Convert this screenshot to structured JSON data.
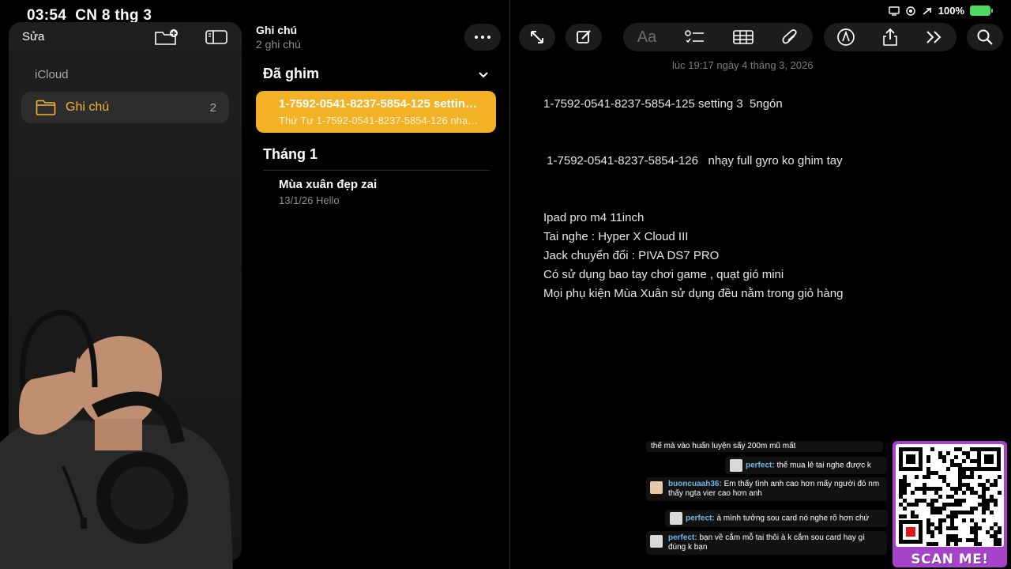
{
  "status_bar": {
    "time": "03:54",
    "date": "CN 8 thg 3",
    "battery": "100%"
  },
  "sidebar": {
    "edit_label": "Sửa",
    "section": "iCloud",
    "folder": {
      "label": "Ghi chú",
      "count": "2"
    }
  },
  "note_list": {
    "title": "Ghi chú",
    "subtitle": "2 ghi chú",
    "pinned_header": "Đã ghim",
    "pinned_note": {
      "title": "1-7592-0541-8237-5854-125 setting 3 5ngón",
      "subtitle": "Thứ Tư  1-7592-0541-8237-5854-126 nhạy full gyro"
    },
    "month_header": "Tháng 1",
    "note": {
      "title": "Mùa xuân đẹp zai",
      "subtitle": "13/1/26  Hello"
    }
  },
  "editor": {
    "timestamp": "lúc 19:17 ngày 4 tháng 3, 2026",
    "format_label": "Aa",
    "lines": [
      "1-7592-0541-8237-5854-125 setting 3  5ngón",
      "",
      "",
      " 1-7592-0541-8237-5854-126   nhạy full gyro ko ghim tay",
      "",
      "",
      "Ipad pro m4 11inch",
      "Tai nghe : Hyper X Cloud III",
      "Jack chuyển đổi : PIVA DS7 PRO",
      "Có sử dụng bao tay chơi game , quạt gió mini",
      "Mọi phụ kiện Mùa Xuân sử dụng đều nằm trong giỏ hàng"
    ]
  },
  "chat": {
    "messages": [
      {
        "name": "",
        "text": "thế mà vào huấn luyện sấy 200m mũ mất"
      },
      {
        "name": "perfect:",
        "text": "thế mua lẻ tai nghe được k"
      },
      {
        "name": "buoncuaah36:",
        "text": "Em thấy tình anh cao hơn mấy người đó nm thấy ngta vier cao hơn anh"
      },
      {
        "name": "perfect:",
        "text": "à mình tưởng sou card nó nghe rõ hơn chứ"
      },
      {
        "name": "perfect:",
        "text": "bạn về cắm mỗ tai thôi à k cắm sou card hay gì đúng k bạn"
      }
    ]
  },
  "qr": {
    "label": "SCAN ME!"
  },
  "colors": {
    "accent": "#f3b125",
    "folder_text": "#f0b72d",
    "qr_frame": "#a544c9"
  }
}
